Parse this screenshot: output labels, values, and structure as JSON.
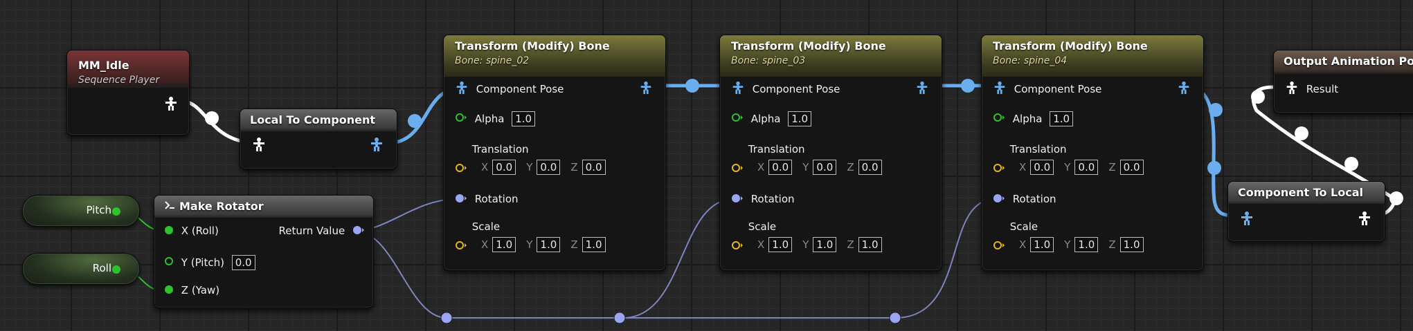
{
  "colors": {
    "exec_pose": "#6aaef0",
    "pose_white": "#ffffff",
    "float_green": "#2ec12e",
    "vector_gold": "#e5b61b",
    "rotator_blue": "#9aa6f2"
  },
  "mm_idle": {
    "title": "MM_Idle",
    "subtitle": "Sequence Player"
  },
  "local_to_component": {
    "title": "Local To Component"
  },
  "make_rotator": {
    "title": "Make Rotator",
    "inputs": [
      "X (Roll)",
      "Y (Pitch)",
      "Z (Yaw)"
    ],
    "pitch_value": "0.0",
    "output": "Return Value"
  },
  "pitch_node": {
    "label": "Pitch"
  },
  "roll_node": {
    "label": "Roll"
  },
  "bones": [
    {
      "title": "Transform (Modify) Bone",
      "bone": "Bone: spine_02"
    },
    {
      "title": "Transform (Modify) Bone",
      "bone": "Bone: spine_03"
    },
    {
      "title": "Transform (Modify) Bone",
      "bone": "Bone: spine_04"
    }
  ],
  "bone_pins": {
    "component_pose": "Component Pose",
    "alpha": "Alpha",
    "alpha_value": "1.0",
    "translation": "Translation",
    "rotation": "Rotation",
    "scale": "Scale",
    "axis_x": "X",
    "axis_y": "Y",
    "axis_z": "Z",
    "translation_values": [
      "0.0",
      "0.0",
      "0.0"
    ],
    "scale_values": [
      "1.0",
      "1.0",
      "1.0"
    ]
  },
  "component_to_local": {
    "title": "Component To Local"
  },
  "output_pose": {
    "title": "Output Animation Pose",
    "result": "Result"
  }
}
